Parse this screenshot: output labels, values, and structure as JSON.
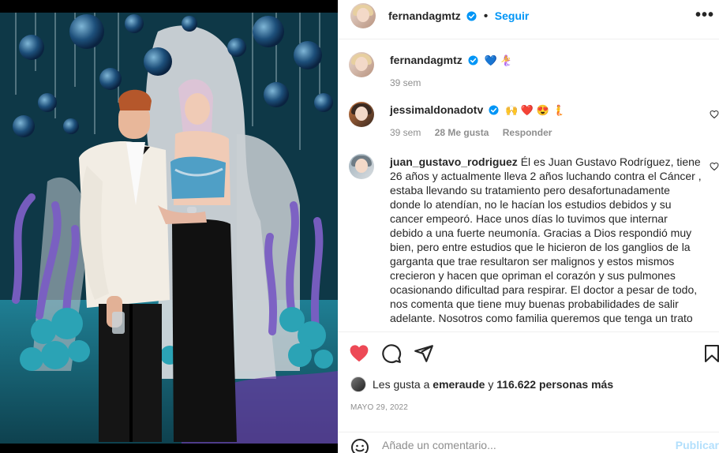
{
  "post": {
    "author": "fernandagmtz",
    "follow_label": "Seguir",
    "more_icon": "more-options-icon"
  },
  "comments": [
    {
      "username": "fernandagmtz",
      "text": "",
      "emojis": "💙 🧜‍♀️",
      "time": "39 sem"
    },
    {
      "username": "jessimaldonadotv",
      "text": "",
      "emojis": "🙌 ❤️ 😍 🧜",
      "time": "39 sem",
      "likes": "28 Me gusta",
      "reply": "Responder"
    },
    {
      "username": "juan_gustavo_rodriguez",
      "text": "Él es Juan Gustavo Rodríguez, tiene 26 años y actualmente lleva 2 años luchando contra el Cáncer , estaba llevando su tratamiento pero desafortunadamente donde lo atendían, no le hacían los estudios debidos y su cancer empeoró. Hace unos días lo tuvimos que internar debido a una fuerte neumonía. Gracias a Dios respondió muy bien, pero entre estudios que le hicieron de los ganglios de la garganta que trae resultaron ser malignos y estos mismos crecieron y hacen que opriman el corazón y sus pulmones ocasionando dificultad para respirar. El doctor a pesar de todo, nos comenta que tiene muy buenas probabilidades de salir adelante. Nosotros como familia queremos que tenga un trato"
    }
  ],
  "likes": {
    "prefix": "Les gusta a",
    "user": "emeraude",
    "conj": "y",
    "count": "116.622 personas más"
  },
  "date": "MAYO 29, 2022",
  "composer": {
    "placeholder": "Añade un comentario...",
    "publish_label": "Publicar"
  },
  "colors": {
    "accent": "#0095f6",
    "like": "#ed4956",
    "publish_disabled": "#b2dffc"
  }
}
